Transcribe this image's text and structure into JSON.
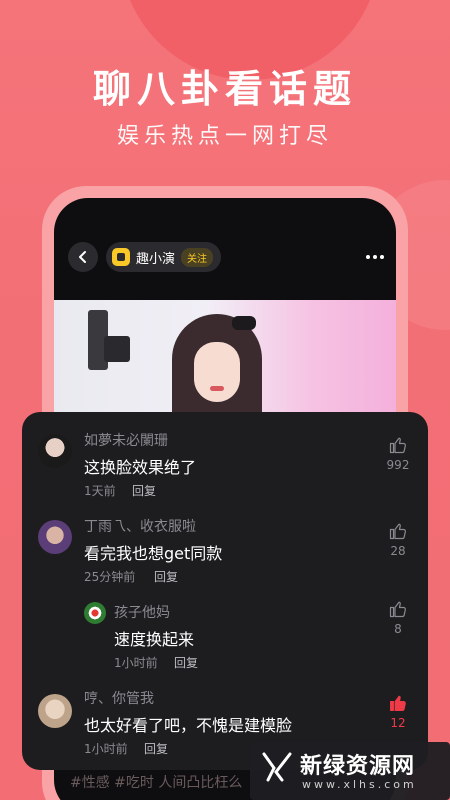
{
  "hero": {
    "title": "聊八卦看话题",
    "subtitle": "娱乐热点一网打尽"
  },
  "phone": {
    "channel_name": "趣小演",
    "follow_label": "关注",
    "bottom_text": "#性感 #吃时 人间凸比枉么"
  },
  "comments": [
    {
      "username": "如夢未必闌珊",
      "text": "这换脸效果绝了",
      "time": "1天前",
      "reply": "回复",
      "likes": "992",
      "liked": false
    },
    {
      "username": "丁雨乁、收衣服啦",
      "text": "看完我也想get同款",
      "time": "25分钟前",
      "reply": "回复",
      "likes": "28",
      "liked": false
    },
    {
      "username": "孩子他妈",
      "text": "速度换起来",
      "time": "1小时前",
      "reply": "回复",
      "likes": "8",
      "liked": false
    },
    {
      "username": "哼、你管我",
      "text": "也太好看了吧，不愧是建模脸",
      "time": "1小时前",
      "reply": "回复",
      "likes": "12",
      "liked": true
    }
  ],
  "watermark": {
    "title": "新绿资源网",
    "url": "www.xlhs.com"
  },
  "colors": {
    "background": "#f36f76",
    "accent_yellow": "#f8c927",
    "like_red": "#ef3b47"
  }
}
